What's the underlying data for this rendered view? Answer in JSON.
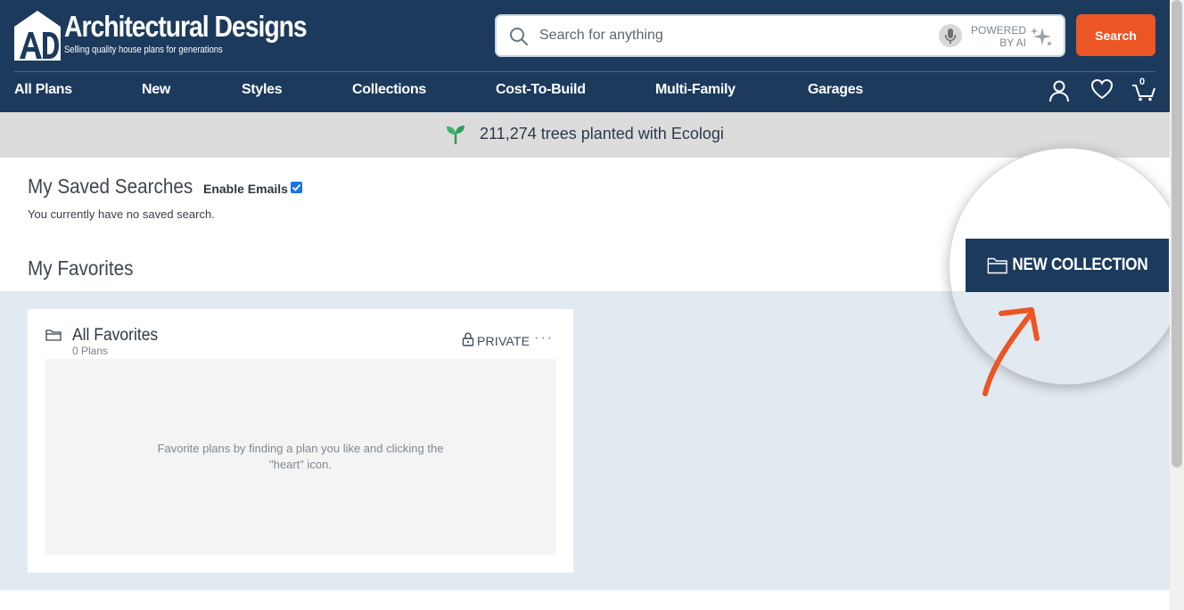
{
  "brand": {
    "logo_mark": "AD",
    "name": "Architectural Designs",
    "tagline": "Selling quality house plans for generations"
  },
  "search": {
    "placeholder": "Search for anything",
    "powered_line1": "POWERED",
    "powered_line2": "BY AI",
    "button_label": "Search"
  },
  "nav": {
    "items": [
      {
        "label": "All Plans"
      },
      {
        "label": "New"
      },
      {
        "label": "Styles"
      },
      {
        "label": "Collections"
      },
      {
        "label": "Cost-To-Build"
      },
      {
        "label": "Multi-Family"
      },
      {
        "label": "Garages"
      }
    ],
    "cart_count": "0"
  },
  "banner": {
    "text": "211,274 trees planted with Ecologi"
  },
  "saved_searches": {
    "title": "My Saved Searches",
    "enable_emails_label": "Enable Emails",
    "enable_emails_checked": true,
    "empty_text": "You currently have no saved search."
  },
  "favorites": {
    "title": "My Favorites",
    "new_collection_label": "NEW COLLECTION",
    "collection": {
      "name": "All Favorites",
      "count": "0 Plans",
      "privacy": "PRIVATE",
      "more": "···",
      "empty_line1": "Favorite plans by finding a plan you like and clicking the",
      "empty_line2": "\"heart\" icon."
    }
  },
  "colors": {
    "header_bg": "#1c3a5c",
    "accent": "#ec5625",
    "banner_bg": "#dcdcdc",
    "favorites_bg": "#e2eaf1"
  }
}
